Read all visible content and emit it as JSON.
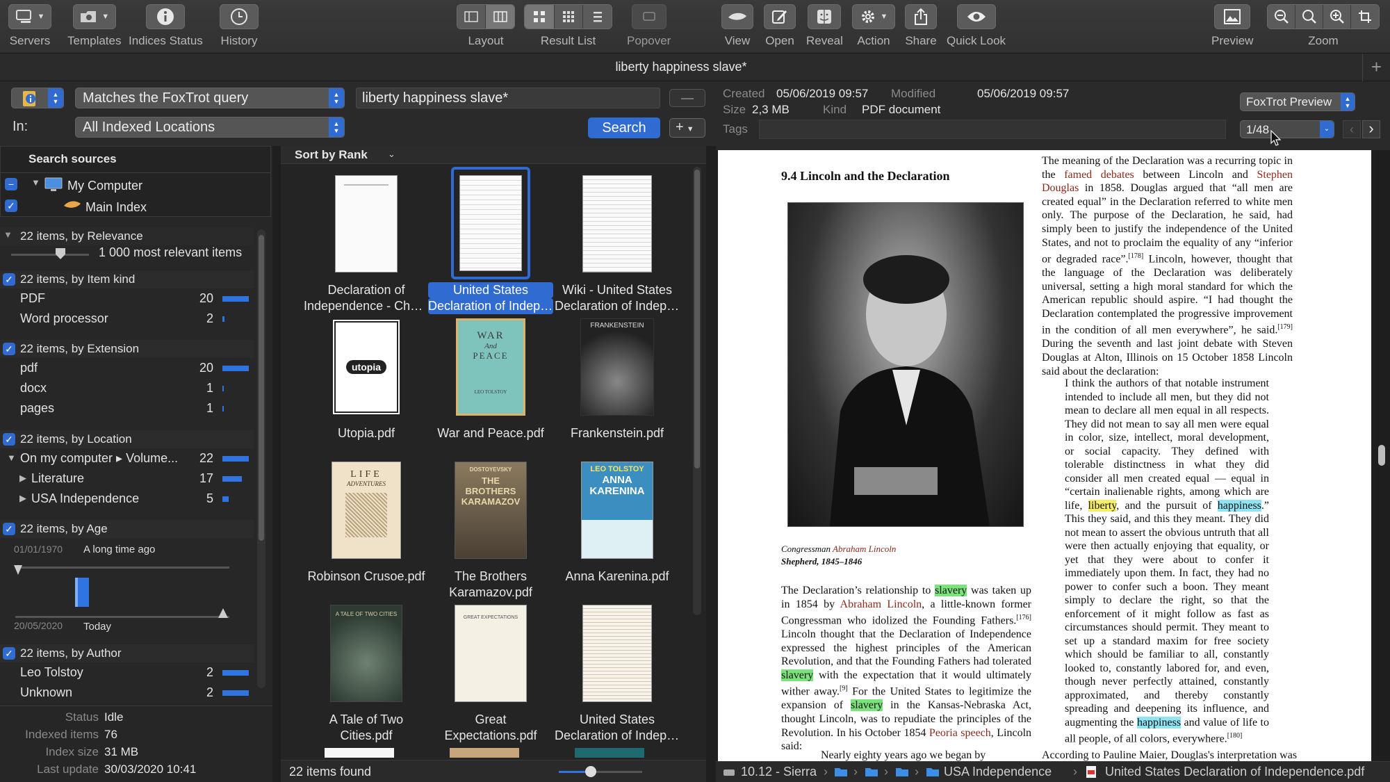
{
  "toolbar": {
    "servers": "Servers",
    "templates": "Templates",
    "indices_status": "Indices Status",
    "history": "History",
    "layout": "Layout",
    "result_list": "Result List",
    "popover": "Popover",
    "view": "View",
    "open": "Open",
    "reveal": "Reveal",
    "action": "Action",
    "share": "Share",
    "quick_look": "Quick Look",
    "preview": "Preview",
    "zoom": "Zoom"
  },
  "window_title": "liberty happiness slave*",
  "query": {
    "mode": "Matches the FoxTrot query",
    "text": "liberty happiness slave*",
    "in_label": "In:",
    "location": "All Indexed Locations",
    "search_button": "Search"
  },
  "sources": {
    "header": "Search sources",
    "my_computer": "My Computer",
    "main_index": "Main Index"
  },
  "filters": {
    "relevance": {
      "title": "22 items, by Relevance",
      "slider_label": "1 000 most relevant items"
    },
    "kind": {
      "title": "22 items, by Item kind",
      "items": [
        {
          "label": "PDF",
          "count": "20"
        },
        {
          "label": "Word processor",
          "count": "2"
        }
      ]
    },
    "extension": {
      "title": "22 items, by Extension",
      "items": [
        {
          "label": "pdf",
          "count": "20"
        },
        {
          "label": "docx",
          "count": "1"
        },
        {
          "label": "pages",
          "count": "1"
        }
      ]
    },
    "location": {
      "title": "22 items, by Location",
      "items": [
        {
          "label": "On my computer ▸ Volume...",
          "count": "22"
        },
        {
          "label": "Literature",
          "count": "17"
        },
        {
          "label": "USA Independence",
          "count": "5"
        }
      ]
    },
    "age": {
      "title": "22 items, by Age",
      "start_date": "01/01/1970",
      "start_label": "A long time ago",
      "end_date": "20/05/2020",
      "end_label": "Today"
    },
    "author": {
      "title": "22 items, by Author",
      "items": [
        {
          "label": "Leo Tolstoy",
          "count": "2"
        },
        {
          "label": "Unknown",
          "count": "2"
        }
      ]
    }
  },
  "status": {
    "status_label": "Status",
    "status_value": "Idle",
    "indexed_label": "Indexed items",
    "indexed_value": "76",
    "size_label": "Index size",
    "size_value": "31 MB",
    "update_label": "Last update",
    "update_value": "30/03/2020 10:41"
  },
  "results": {
    "sort": "Sort by Rank",
    "found": "22 items found",
    "items": [
      {
        "name": "Declaration of Independence - Chec...",
        "l1": "Declaration of",
        "l2": "Independence - Chec..."
      },
      {
        "name": "United States Declaration of Indepen...",
        "l1": "United States",
        "l2": "Declaration of Indepen..."
      },
      {
        "name": "Wiki - United States Declaration of Indepen...",
        "l1": "Wiki - United States",
        "l2": "Declaration of Indepen..."
      },
      {
        "name": "Utopia.pdf",
        "l1": "Utopia.pdf",
        "l2": ""
      },
      {
        "name": "War and Peace.pdf",
        "l1": "War and Peace.pdf",
        "l2": ""
      },
      {
        "name": "Frankenstein.pdf",
        "l1": "Frankenstein.pdf",
        "l2": ""
      },
      {
        "name": "Robinson Crusoe.pdf",
        "l1": "Robinson Crusoe.pdf",
        "l2": ""
      },
      {
        "name": "The Brothers Karamazov.pdf",
        "l1": "The Brothers",
        "l2": "Karamazov.pdf"
      },
      {
        "name": "Anna Karenina.pdf",
        "l1": "Anna Karenina.pdf",
        "l2": ""
      },
      {
        "name": "A Tale of Two Cities.pdf",
        "l1": "A Tale of Two",
        "l2": "Cities.pdf"
      },
      {
        "name": "Great Expectations.pdf",
        "l1": "Great",
        "l2": "Expectations.pdf"
      },
      {
        "name": "United States Declaration of Indepen...",
        "l1": "United States",
        "l2": "Declaration of Indepen..."
      }
    ],
    "covers": {
      "utopia": "utopia",
      "war1": "WAR",
      "war2": "And",
      "war3": "PEACE",
      "war4": "LEO TOLSTOY",
      "frank": "FRANKENSTEIN",
      "robinson1": "LIFE",
      "robinson2": "ADVENTURES",
      "karamazov1": "DOSTOYEVSKY",
      "karamazov2": "THE BROTHERS KARAMAZOV",
      "anna1": "LEO TOLSTOY",
      "anna2": "ANNA KARENINA",
      "tale": "A TALE OF TWO CITIES",
      "great": "GREAT EXPECTATIONS"
    }
  },
  "meta": {
    "created_label": "Created",
    "created_value": "05/06/2019 09:57",
    "modified_label": "Modified",
    "modified_value": "05/06/2019 09:57",
    "size_label": "Size",
    "size_value": "2,3 MB",
    "kind_label": "Kind",
    "kind_value": "PDF document",
    "tags_label": "Tags",
    "preview_mode": "FoxTrot Preview",
    "page": "1/48"
  },
  "document": {
    "heading": "9.4   Lincoln and the Declaration",
    "caption_l1a": "Congressman ",
    "caption_l1b": "Abraham Lincoln",
    "caption_l2": "Shepherd, 1845–1846",
    "col1_last": "Nearly eighty years ago we began by",
    "col2_last": "According to Pauline Maier, Douglas's interpretation was"
  },
  "pathbar": [
    "10.12 - Sierra",
    "USA Independence",
    "United States Declaration of Independence.pdf"
  ],
  "colors": {
    "accent": "#2f6bd0",
    "bar": "#2f74e0",
    "highlight_green": "#7be37b",
    "highlight_blue": "#8fe3f3",
    "highlight_yellow": "#f5ee66"
  }
}
